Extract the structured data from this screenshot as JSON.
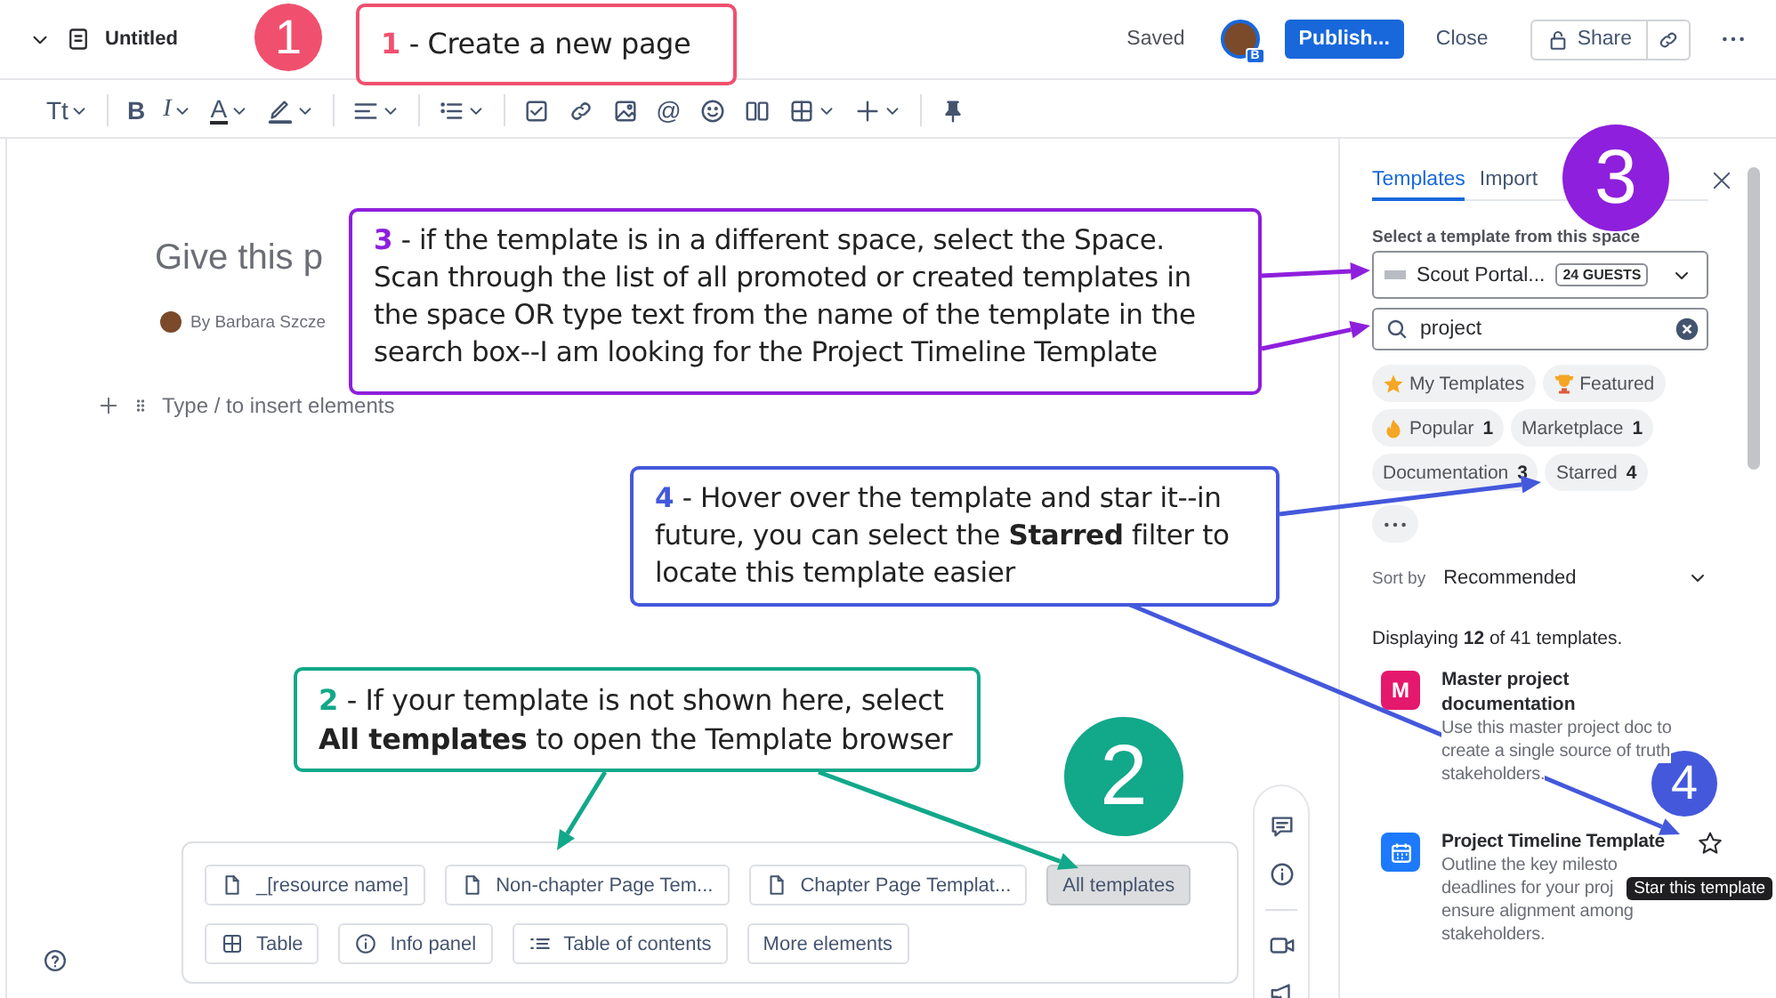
{
  "top_bar": {
    "title": "Untitled",
    "status": "Saved",
    "avatar_badge": "B",
    "publish": "Publish...",
    "close": "Close",
    "share": "Share"
  },
  "toolbar_groups": [
    {
      "items": [
        {
          "kind": "text-style",
          "label": "Tt",
          "dropdown": true
        }
      ]
    },
    {
      "items": [
        {
          "kind": "bold",
          "label": "B",
          "dropdown": false
        },
        {
          "kind": "italic",
          "label": "I",
          "dropdown": true
        },
        {
          "kind": "text-color",
          "label": "A",
          "dropdown": true
        },
        {
          "kind": "highlight",
          "dropdown": true
        }
      ]
    },
    {
      "items": [
        {
          "kind": "align",
          "dropdown": true
        }
      ]
    },
    {
      "items": [
        {
          "kind": "bullets",
          "dropdown": true
        }
      ]
    },
    {
      "items": [
        {
          "kind": "task",
          "dropdown": false
        },
        {
          "kind": "link",
          "dropdown": false
        },
        {
          "kind": "image",
          "dropdown": false
        },
        {
          "kind": "mention",
          "label": "@",
          "dropdown": false
        },
        {
          "kind": "emoji",
          "dropdown": false
        },
        {
          "kind": "columns",
          "dropdown": false
        },
        {
          "kind": "table",
          "dropdown": true
        },
        {
          "kind": "insert",
          "dropdown": true
        }
      ]
    },
    {
      "items": [
        {
          "kind": "pin",
          "dropdown": false
        }
      ]
    }
  ],
  "editor": {
    "title_placeholder": "Give this p",
    "byline": "By Barbara Szcze",
    "insert_hint": "Type / to insert elements"
  },
  "suggestion_rows": [
    {
      "buttons": [
        {
          "kind": "template",
          "label": "_[resource name]"
        },
        {
          "kind": "template",
          "label": "Non-chapter Page Tem..."
        },
        {
          "kind": "template",
          "label": "Chapter Page Templat..."
        },
        {
          "kind": "browse",
          "label": "All templates"
        }
      ]
    },
    {
      "buttons": [
        {
          "kind": "table",
          "label": "Table"
        },
        {
          "kind": "info",
          "label": "Info panel"
        },
        {
          "kind": "toc",
          "label": "Table of contents"
        },
        {
          "kind": "plain",
          "label": "More elements"
        }
      ]
    }
  ],
  "panel": {
    "tabs": [
      {
        "label": "Templates",
        "selected": true
      },
      {
        "label": "Import",
        "selected": false
      }
    ],
    "space_label": "Select a template from this space",
    "space": "Scout Portal...",
    "space_badge": "24 GUESTS",
    "search": {
      "value": "project"
    },
    "filters": [
      {
        "kind": "star",
        "label": "My Templates",
        "selected": false
      },
      {
        "kind": "trophy",
        "label": "Featured",
        "selected": false
      },
      {
        "kind": "fire",
        "label": "Popular",
        "count": "1",
        "selected": false
      },
      {
        "kind": "plain",
        "label": "Marketplace",
        "count": "1",
        "selected": false
      },
      {
        "kind": "plain",
        "label": "Documentation",
        "count": "3",
        "selected": false
      },
      {
        "kind": "plain",
        "label": "Starred",
        "count": "4",
        "selected": false
      }
    ],
    "sort_label": "Sort by",
    "sort_value": "Recommended",
    "summary": "Displaying **12** of 41 templates.",
    "templates": [
      {
        "kind": "letter",
        "logo_letter": "M",
        "color": "#e4186c",
        "title": "Master project documentation",
        "description_lines": [
          "Use this master project doc to",
          "create a single source of truth",
          "stakeholders."
        ],
        "hovered": false,
        "starred": false
      },
      {
        "kind": "calendar",
        "color": "#1d7afc",
        "title": "Project Timeline Template",
        "description_lines": [
          "Outline the key milesto",
          "deadlines for your proj",
          "ensure alignment among",
          "stakeholders."
        ],
        "hovered": true,
        "starred": false,
        "tooltip": "Star this template"
      }
    ]
  },
  "annotations": [
    {
      "badge": "1",
      "number": "1",
      "text": "- Create a new page",
      "color": "#f0506e"
    },
    {
      "badge": "3",
      "number": "3",
      "text": "- if the template is in a different space, select the Space. Scan through the list of all promoted or created templates in the space OR type text from the name of the template in the search box--I am looking for the Project Timeline Template",
      "color": "#8e1fdc"
    },
    {
      "badge": "4",
      "number": "4",
      "text": "- Hover over the template and star it--in future, you can select the **Starred** filter to locate this template easier",
      "color": "#4458dc"
    },
    {
      "badge": "2",
      "number": "2",
      "text": "- If your template is not shown here, select **All templates** to open the Template browser",
      "color": "#12a88a"
    }
  ]
}
